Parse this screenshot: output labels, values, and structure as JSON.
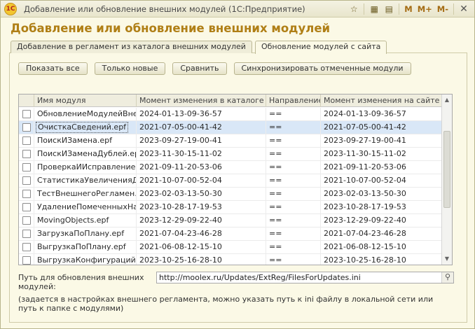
{
  "window": {
    "title": "Добавление или обновление внешних модулей  (1С:Предприятие)",
    "logo_text": "1С",
    "toolbar_icons": [
      "star-icon",
      "calculator-icon",
      "calendar-icon"
    ],
    "m_labels": [
      "M",
      "M+",
      "M-"
    ]
  },
  "heading": "Добавление или обновление внешних модулей",
  "tabs": [
    {
      "label": "Добавление в регламент из каталога внешних модулей",
      "active": false
    },
    {
      "label": "Обновление модулей с сайта",
      "active": true
    }
  ],
  "buttons": {
    "show_all": "Показать все",
    "only_new": "Только новые",
    "compare": "Сравнить",
    "sync": "Синхронизировать отмеченные модули"
  },
  "table": {
    "columns": [
      "Имя модуля",
      "Момент изменения в каталоге",
      "Направление",
      "Момент изменения на сайте"
    ],
    "selected_row": 1,
    "rows": [
      {
        "name": "ОбновлениеМодулейВне...",
        "catalog": "2024-01-13-09-36-57",
        "direction": "==",
        "site": "2024-01-13-09-36-57"
      },
      {
        "name": "ОчисткаСведений.epf",
        "catalog": "2021-07-05-00-41-42",
        "direction": "==",
        "site": "2021-07-05-00-41-42"
      },
      {
        "name": "ПоискИЗамена.epf",
        "catalog": "2023-09-27-19-00-41",
        "direction": "==",
        "site": "2023-09-27-19-00-41"
      },
      {
        "name": "ПоискИЗаменаДублей.epf",
        "catalog": "2023-11-30-15-11-02",
        "direction": "==",
        "site": "2023-11-30-15-11-02"
      },
      {
        "name": "ПроверкаИИсправление...",
        "catalog": "2021-09-11-20-53-06",
        "direction": "==",
        "site": "2021-09-11-20-53-06"
      },
      {
        "name": "СтатистикаУвеличенияД...",
        "catalog": "2021-10-07-00-52-04",
        "direction": "==",
        "site": "2021-10-07-00-52-04"
      },
      {
        "name": "ТестВнешнегоРегламен...",
        "catalog": "2023-02-03-13-50-30",
        "direction": "==",
        "site": "2023-02-03-13-50-30"
      },
      {
        "name": "УдалениеПомеченныхНа...",
        "catalog": "2023-10-28-17-19-53",
        "direction": "==",
        "site": "2023-10-28-17-19-53"
      },
      {
        "name": "MovingObjects.epf",
        "catalog": "2023-12-29-09-22-40",
        "direction": "==",
        "site": "2023-12-29-09-22-40"
      },
      {
        "name": "ЗагрузкаПоПлану.epf",
        "catalog": "2021-07-04-23-46-28",
        "direction": "==",
        "site": "2021-07-04-23-46-28"
      },
      {
        "name": "ВыгрузкаПоПлану.epf",
        "catalog": "2021-06-08-12-15-10",
        "direction": "==",
        "site": "2021-06-08-12-15-10"
      },
      {
        "name": "ВыгрузкаКонфигураций...",
        "catalog": "2023-10-25-16-28-10",
        "direction": "==",
        "site": "2023-10-25-16-28-10"
      }
    ]
  },
  "path": {
    "label": "Путь для обновления внешних модулей:",
    "value": "http://moolex.ru/Updates/ExtReg/FilesForUpdates.ini"
  },
  "note": "(задается в настройках внешнего регламента, можно указать путь к ini файлу в локальной сети или путь к папке с модулями)"
}
